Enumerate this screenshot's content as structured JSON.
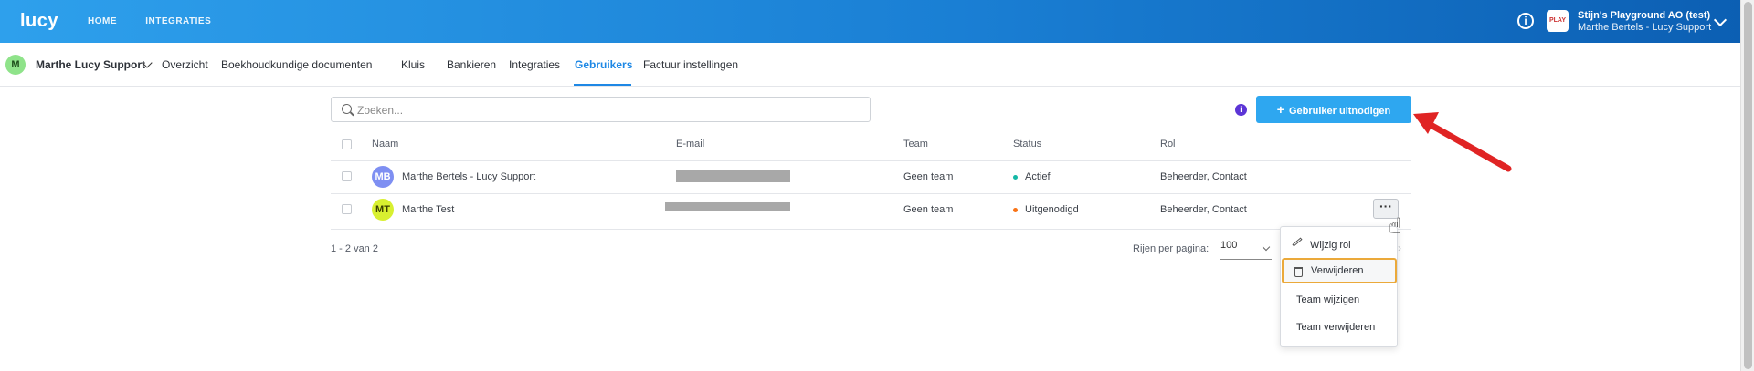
{
  "app": {
    "logo": "lucy"
  },
  "topnav": {
    "items": [
      "HOME",
      "INTEGRATIES"
    ]
  },
  "org": {
    "logo_text": "PLAY",
    "name": "Stijn's Playground AO (test)",
    "user": "Marthe Bertels - Lucy Support"
  },
  "company": {
    "initial": "M",
    "name": "Marthe Lucy Support"
  },
  "tabs": [
    "Overzicht",
    "Boekhoudkundige documenten",
    "Kluis",
    "Bankieren",
    "Integraties",
    "Gebruikers",
    "Factuur instellingen"
  ],
  "active_tab": "Gebruikers",
  "search": {
    "placeholder": "Zoeken..."
  },
  "invite_button": {
    "label": "Gebruiker uitnodigen"
  },
  "table": {
    "columns": [
      "Naam",
      "E-mail",
      "Team",
      "Status",
      "Rol"
    ],
    "rows": [
      {
        "initials": "MB",
        "name": "Marthe Bertels - Lucy Support",
        "team": "Geen team",
        "status": "Actief",
        "status_color": "#14b8a6",
        "role": "Beheerder, Contact"
      },
      {
        "initials": "MT",
        "name": "Marthe Test",
        "team": "Geen team",
        "status": "Uitgenodigd",
        "status_color": "#f97316",
        "role": "Beheerder, Contact"
      }
    ]
  },
  "pagination": {
    "range": "1 - 2 van 2",
    "rows_per_page_label": "Rijen per pagina:",
    "rows_per_page": "100"
  },
  "context_menu": {
    "items": [
      "Wijzig rol",
      "Verwijderen",
      "Team wijzigen",
      "Team verwijderen"
    ],
    "highlighted": "Verwijderen"
  },
  "colors": {
    "primary": "#2ea7f0",
    "highlight_border": "#eba93a",
    "arrow": "#e02424"
  }
}
